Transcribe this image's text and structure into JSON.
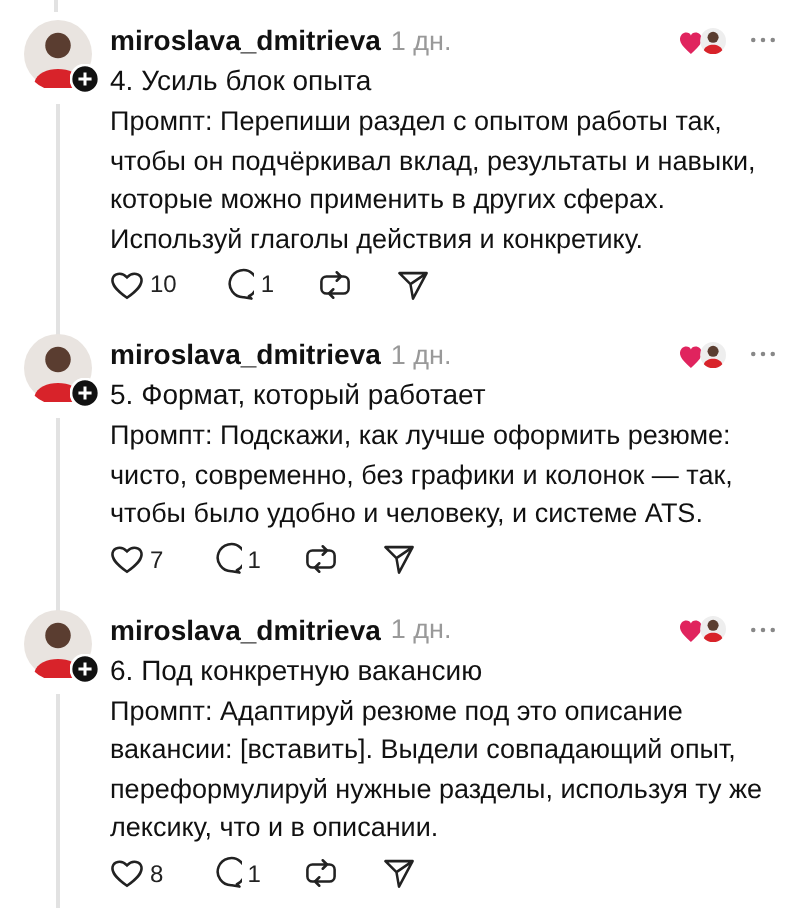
{
  "posts": [
    {
      "username": "miroslava_dmitrieva",
      "time": "1 дн.",
      "title": "4. Усиль блок опыта",
      "body": [
        "Промпт: Перепиши раздел с опытом работы так,",
        "чтобы он подчёркивал вклад, результаты и навыки,",
        "которые можно применить в других сферах.",
        "Используй глаголы действия и конкретику."
      ],
      "likes": "10",
      "replies": "1",
      "author_liked": true
    },
    {
      "username": "miroslava_dmitrieva",
      "time": "1 дн.",
      "title": "5. Формат, который работает",
      "body": [
        "Промпт: Подскажи, как лучше оформить резюме:",
        "чисто, современно, без графики и колонок — так,",
        "чтобы было удобно и человеку, и системе ATS."
      ],
      "likes": "7",
      "replies": "1",
      "author_liked": true
    },
    {
      "username": "miroslava_dmitrieva",
      "time": "1 дн.",
      "title": "6. Под конкретную вакансию",
      "body": [
        "Промпт: Адаптируй резюме под это описание",
        "вакансии: [вставить]. Выдели совпадающий опыт,",
        "переформулируй нужные разделы, используя ту же",
        "лексику, что и в описании."
      ],
      "likes": "8",
      "replies": "1",
      "author_liked": true
    }
  ]
}
